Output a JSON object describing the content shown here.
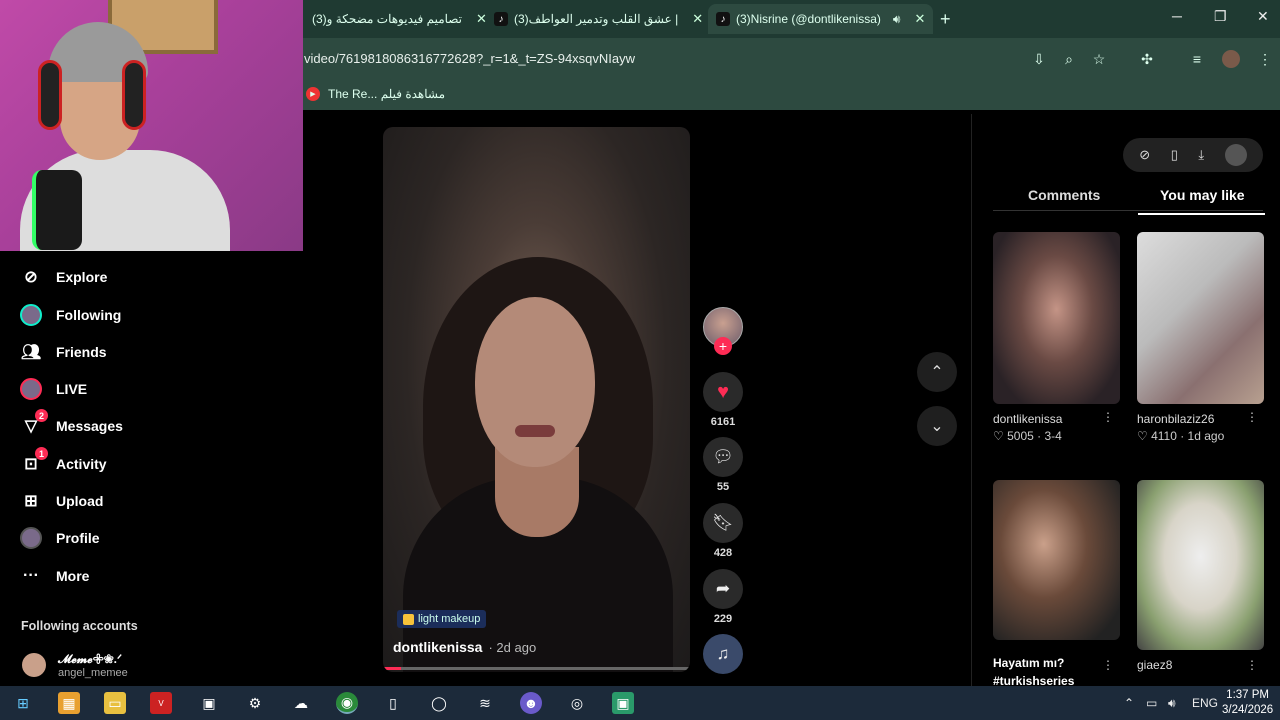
{
  "browser": {
    "tabs": [
      {
        "label": "(3)تصاميم فيديوهات مضحكة و"
      },
      {
        "label": "(3)عشق القلب وتدمير العواطف |"
      },
      {
        "label": "(3)Nisrine (@dontlikenissa)"
      }
    ],
    "url": "video/7619818086316772628?_r=1&_t=ZS-94xsqvNIayw",
    "bookmark": "The Re... مشاهدة فيلم"
  },
  "nav": {
    "items": [
      {
        "label": "Explore",
        "icon": "compass-icon"
      },
      {
        "label": "Following",
        "icon": "avatar-icon"
      },
      {
        "label": "Friends",
        "icon": "friends-icon"
      },
      {
        "label": "LIVE",
        "icon": "live-icon"
      },
      {
        "label": "Messages",
        "icon": "messages-icon",
        "badge": "2"
      },
      {
        "label": "Activity",
        "icon": "activity-icon",
        "badge": "1"
      },
      {
        "label": "Upload",
        "icon": "upload-icon"
      },
      {
        "label": "Profile",
        "icon": "profile-icon"
      },
      {
        "label": "More",
        "icon": "more-icon"
      }
    ],
    "following_title": "Following accounts",
    "account": {
      "name": "𝓜𝓮𝓶𝓮𖧷❀.ᐟ",
      "handle": "angel_memee"
    }
  },
  "video": {
    "tag": "light makeup",
    "author": "dontlikenissa",
    "ago": "· 2d ago",
    "progress": 0.06
  },
  "actions": {
    "likes": "6161",
    "comments": "55",
    "saves": "428",
    "shares": "229"
  },
  "panel": {
    "tabs": [
      "Comments",
      "You may like"
    ],
    "cards": [
      {
        "author": "dontlikenissa",
        "meta": "♡ 5005 · 3-4"
      },
      {
        "author": "haronbilaziz26",
        "meta": "♡ 4110 · 1d ago"
      },
      {
        "title": "Hayatım mı? #turkishseries"
      },
      {
        "author": "giaez8"
      }
    ]
  },
  "taskbar": {
    "lang": "ENG",
    "time": "1:37 PM",
    "date": "3/24/2026"
  },
  "colors": {
    "accent": "#fe2c55",
    "chrome": "#2d4a40"
  }
}
